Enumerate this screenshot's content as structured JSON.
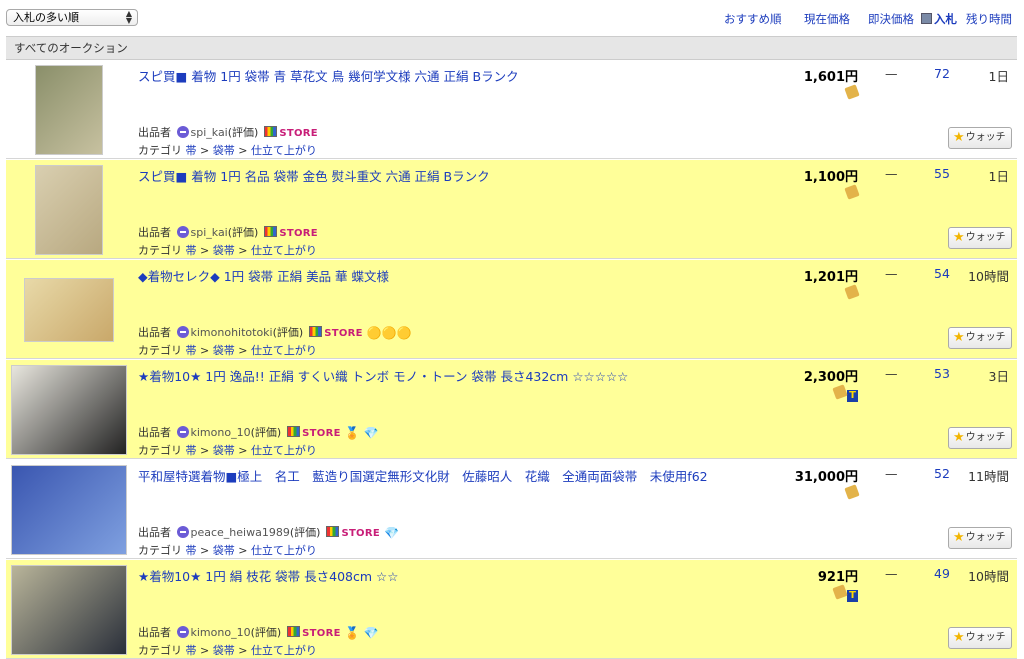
{
  "toolbar": {
    "sort_value": "入札の多い順"
  },
  "columns": {
    "recommended": "おすすめ順",
    "current_price": "現在価格",
    "buy_now_price": "即決価格",
    "bids": "入札",
    "remaining": "残り時間"
  },
  "section_title": "すべてのオークション",
  "common": {
    "seller_label": "出品者",
    "rating_label": "(評価)",
    "store_label": "STORE",
    "category_label": "カテゴリ",
    "watch_label": "ウォッチ",
    "currency": "円",
    "dash": "—",
    "sep": ">"
  },
  "listings": [
    {
      "title": "スピ買■ 着物 1円 袋帯 青 草花文 鳥 幾何学文様 六通 正絹 Bランク",
      "seller": "spi_kai",
      "price": "1,601",
      "bids": "72",
      "remaining": "1日",
      "highlight": false,
      "category": [
        "帯",
        "袋帯",
        "仕立て上がり"
      ],
      "thumb_colors": [
        "#8a8f6a",
        "#c7c1a0"
      ]
    },
    {
      "title": "スピ買■ 着物 1円 名品 袋帯 金色 熨斗重文 六通 正絹 Bランク",
      "seller": "spi_kai",
      "price": "1,100",
      "bids": "55",
      "remaining": "1日",
      "highlight": true,
      "category": [
        "帯",
        "袋帯",
        "仕立て上がり"
      ],
      "thumb_colors": [
        "#d9cfb0",
        "#b8a880"
      ]
    },
    {
      "title": "◆着物セレク◆ 1円 袋帯 正絹 美品 華 蝶文様",
      "seller": "kimonohitotoki",
      "price": "1,201",
      "bids": "54",
      "remaining": "10時間",
      "highlight": true,
      "category": [
        "帯",
        "袋帯",
        "仕立て上がり"
      ],
      "thumb_colors": [
        "#e8d9a8",
        "#c9a86a"
      ]
    },
    {
      "title": "★着物10★ 1円 逸品!! 正絹 すくい織 トンボ モノ・トーン 袋帯 長さ432cm ☆☆☆☆☆",
      "seller": "kimono_10",
      "price": "2,300",
      "bids": "53",
      "remaining": "3日",
      "highlight": true,
      "category": [
        "帯",
        "袋帯",
        "仕立て上がり"
      ],
      "thumb_colors": [
        "#e8e6de",
        "#222222"
      ]
    },
    {
      "title": "平和屋特選着物■極上　名工　藍造り国選定無形文化財　佐藤昭人　花織　全通両面袋帯　未使用f62",
      "seller": "peace_heiwa1989",
      "price": "31,000",
      "bids": "52",
      "remaining": "11時間",
      "highlight": false,
      "category": [
        "帯",
        "袋帯",
        "仕立て上がり"
      ],
      "thumb_colors": [
        "#3a56b0",
        "#7fa0e0"
      ]
    },
    {
      "title": "★着物10★ 1円 絹 枝花 袋帯 長さ408cm ☆☆",
      "seller": "kimono_10",
      "price": "921",
      "bids": "49",
      "remaining": "10時間",
      "highlight": true,
      "category": [
        "帯",
        "袋帯",
        "仕立て上がり"
      ],
      "thumb_colors": [
        "#b9b59a",
        "#2a2f3a"
      ]
    }
  ]
}
